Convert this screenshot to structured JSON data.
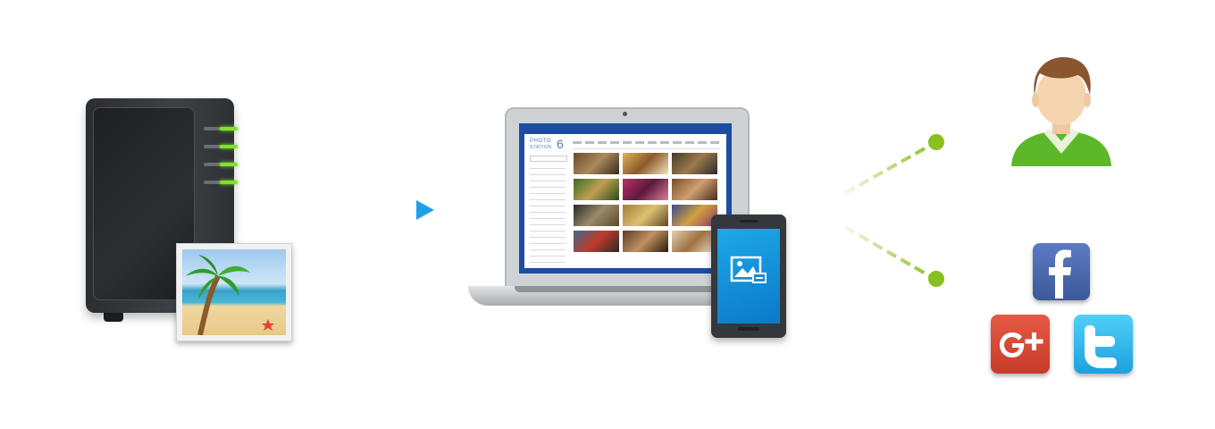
{
  "diagram": {
    "laptop_app": {
      "logo_line1": "PHOTO",
      "logo_line2": "STATION",
      "logo_number": "6"
    },
    "icons": {
      "nas": "nas-server-icon",
      "photo": "beach-photo-icon",
      "laptop": "laptop-icon",
      "phone": "smartphone-icon",
      "person": "user-avatar-icon",
      "facebook": "facebook-icon",
      "google_plus": "google-plus-icon",
      "twitter": "twitter-icon"
    },
    "colors": {
      "flow_arrow": "#1ea0e8",
      "share_lines": "#88c020",
      "nas_led": "#7ee32a",
      "screen": "#1d4d9f",
      "facebook": "#3b5998",
      "google_plus": "#d34836",
      "twitter": "#1da1e0"
    }
  }
}
